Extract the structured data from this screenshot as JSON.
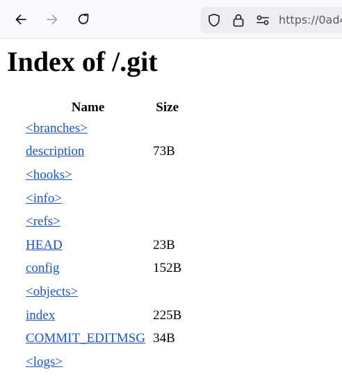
{
  "browser": {
    "url_text": "https://0ad4"
  },
  "page": {
    "title": "Index of /.git",
    "columns": {
      "name": "Name",
      "size": "Size"
    },
    "rows": [
      {
        "name": "<branches>",
        "size": ""
      },
      {
        "name": "description",
        "size": "73B"
      },
      {
        "name": "<hooks>",
        "size": ""
      },
      {
        "name": "<info>",
        "size": ""
      },
      {
        "name": "<refs>",
        "size": ""
      },
      {
        "name": "HEAD",
        "size": "23B"
      },
      {
        "name": "config",
        "size": "152B"
      },
      {
        "name": "<objects>",
        "size": ""
      },
      {
        "name": "index",
        "size": "225B"
      },
      {
        "name": "COMMIT_EDITMSG",
        "size": "34B"
      },
      {
        "name": "<logs>",
        "size": ""
      }
    ]
  },
  "icons": {
    "back": "arrow-left-icon",
    "forward": "arrow-right-icon",
    "reload": "reload-icon",
    "shield": "shield-icon",
    "lock": "lock-icon",
    "permissions": "permissions-icon"
  },
  "colors": {
    "link": "#1a55c4",
    "toolbar_bg": "#f9f9fb",
    "urlbar_bg": "#eeeef2"
  }
}
